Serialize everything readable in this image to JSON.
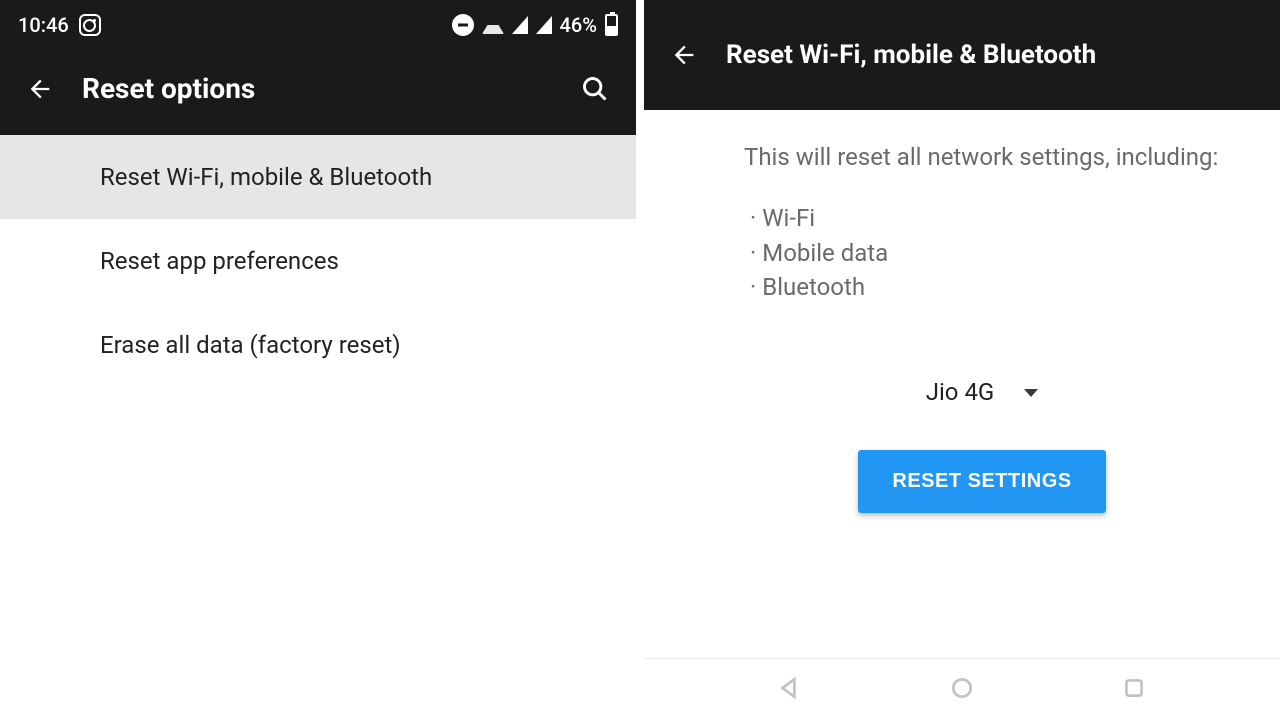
{
  "statusbar": {
    "time": "10:46",
    "battery_pct": "46%"
  },
  "left": {
    "title": "Reset options",
    "items": [
      "Reset Wi-Fi, mobile & Bluetooth",
      "Reset app preferences",
      "Erase all data (factory reset)"
    ]
  },
  "right": {
    "title": "Reset Wi-Fi, mobile & Bluetooth",
    "explain": "This will reset all network settings, including:",
    "bullets": [
      "Wi-Fi",
      "Mobile data",
      "Bluetooth"
    ],
    "sim": "Jio 4G",
    "reset_button": "RESET SETTINGS"
  }
}
